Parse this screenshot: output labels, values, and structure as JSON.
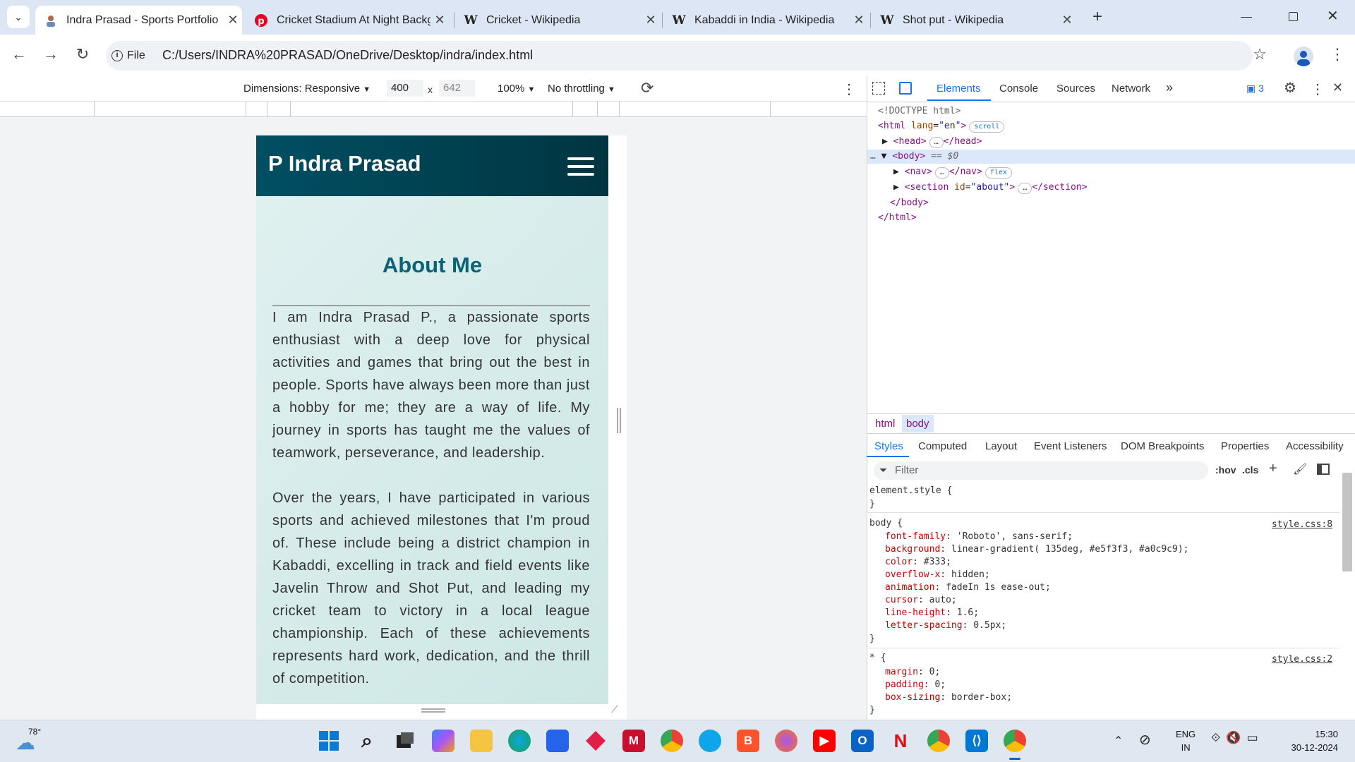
{
  "browser": {
    "tabs": [
      {
        "title": "Indra Prasad - Sports Portfolio",
        "icon": "person-favicon-icon",
        "active": true
      },
      {
        "title": "Cricket Stadium At Night Backg",
        "icon": "pinterest-icon"
      },
      {
        "title": "Cricket - Wikipedia",
        "icon": "wikipedia-icon"
      },
      {
        "title": "Kabaddi in India - Wikipedia",
        "icon": "wikipedia-icon"
      },
      {
        "title": "Shot put - Wikipedia",
        "icon": "wikipedia-icon"
      }
    ],
    "wiki_letter": "W",
    "file_chip": "File",
    "address": "C:/Users/INDRA%20PRASAD/OneDrive/Desktop/indra/index.html"
  },
  "device_toolbar": {
    "dimensions": "Dimensions: Responsive",
    "width": "400",
    "times": "x",
    "height": "642",
    "zoom": "100%",
    "throttling": "No throttling"
  },
  "site": {
    "title": "P Indra Prasad",
    "about_title": "About Me",
    "paragraph_1": "I am Indra Prasad P., a passionate sports enthusiast with a deep love for physical activities and games that bring out the best in people. Sports have always been more than just a hobby for me; they are a way of life. My journey in sports has taught me the values of teamwork, perseverance, and leadership.",
    "paragraph_2": "Over the years, I have participated in various sports and achieved milestones that I'm proud of. These include being a district champion in Kabaddi, excelling in track and field events like Javelin Throw and Shot Put, and leading my cricket team to victory in a local league championship. Each of these achievements represents hard work, dedication, and the thrill of competition."
  },
  "devtools": {
    "tabs": [
      "Elements",
      "Console",
      "Sources",
      "Network"
    ],
    "issues_count": "3",
    "dom": {
      "doctype": "<!DOCTYPE html>",
      "html_open": "<html",
      "html_attr": "lang",
      "html_val": "\"en\"",
      "scroll_badge": "scroll",
      "head_open": "<head>",
      "head_close": "</head>",
      "body_open": "<body>",
      "body_sel": "== $0",
      "nav_open": "<nav>",
      "nav_close": "</nav>",
      "flex_badge": "flex",
      "section_open": "<section",
      "section_attr": "id",
      "section_val": "\"about\"",
      "section_close": "</section>",
      "body_close": "</body>",
      "html_close": "</html>",
      "ellipsis": "…"
    },
    "breadcrumbs": [
      "html",
      "body"
    ],
    "styles_tabs": [
      "Styles",
      "Computed",
      "Layout",
      "Event Listeners",
      "DOM Breakpoints",
      "Properties",
      "Accessibility"
    ],
    "filter_placeholder": "Filter",
    "hov": ":hov",
    "cls": ".cls",
    "element_style": "element.style {",
    "close_brace": "}",
    "body_rule": {
      "selector": "body {",
      "source": "style.css:8",
      "props": [
        {
          "name": "font-family",
          "value": "'Roboto', sans-serif;"
        },
        {
          "name": "background",
          "value": "linear-gradient(  135deg,   #e5f3f3,   #a0c9c9);"
        },
        {
          "name": "color",
          "value": "#333;"
        },
        {
          "name": "overflow-x",
          "value": "hidden;"
        },
        {
          "name": "animation",
          "value": "fadeIn 1s  ease-out;"
        },
        {
          "name": "cursor",
          "value": "auto;"
        },
        {
          "name": "line-height",
          "value": "1.6;"
        },
        {
          "name": "letter-spacing",
          "value": "0.5px;"
        }
      ]
    },
    "star_rule": {
      "selector": "* {",
      "source": "style.css:2",
      "props": [
        {
          "name": "margin",
          "value": "0;"
        },
        {
          "name": "padding",
          "value": "0;"
        },
        {
          "name": "box-sizing",
          "value": "border-box;"
        }
      ]
    }
  },
  "taskbar": {
    "temperature": "78°",
    "lang_1": "ENG",
    "lang_2": "IN",
    "time": "15:30",
    "date": "30-12-2024"
  },
  "colors": {
    "nav_dark": "#003540",
    "accent_teal": "#0b6175",
    "devtools_blue": "#1a73e8"
  }
}
